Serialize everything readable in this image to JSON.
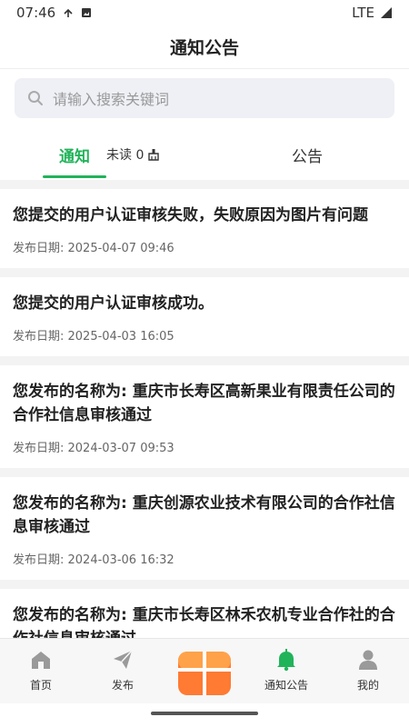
{
  "status_bar": {
    "time": "07:46",
    "network": "LTE"
  },
  "header": {
    "title": "通知公告"
  },
  "search": {
    "placeholder": "请输入搜索关键词"
  },
  "tabs": {
    "notice_label": "通知",
    "unread_label": "未读 0",
    "announce_label": "公告"
  },
  "notices": [
    {
      "title": "您提交的用户认证审核失败，失败原因为图片有问题",
      "date": "发布日期: 2025-04-07 09:46"
    },
    {
      "title": "您提交的用户认证审核成功。",
      "date": "发布日期: 2025-04-03 16:05"
    },
    {
      "title": "您发布的名称为: 重庆市长寿区高新果业有限责任公司的合作社信息审核通过",
      "date": "发布日期: 2024-03-07 09:53"
    },
    {
      "title": "您发布的名称为: 重庆创源农业技术有限公司的合作社信息审核通过",
      "date": "发布日期: 2024-03-06 16:32"
    },
    {
      "title": "您发布的名称为: 重庆市长寿区林禾农机专业合作社的合作社信息审核通过",
      "date": ""
    }
  ],
  "bottom_nav": {
    "home": "首页",
    "publish": "发布",
    "notice": "通知公告",
    "mine": "我的"
  },
  "colors": {
    "accent": "#21b35a",
    "center_button": "#ff7a33"
  },
  "icons": {
    "home": "home-icon",
    "publish": "paper-plane-icon",
    "center": "grid-box-icon",
    "notice": "bell-icon",
    "mine": "user-icon"
  }
}
